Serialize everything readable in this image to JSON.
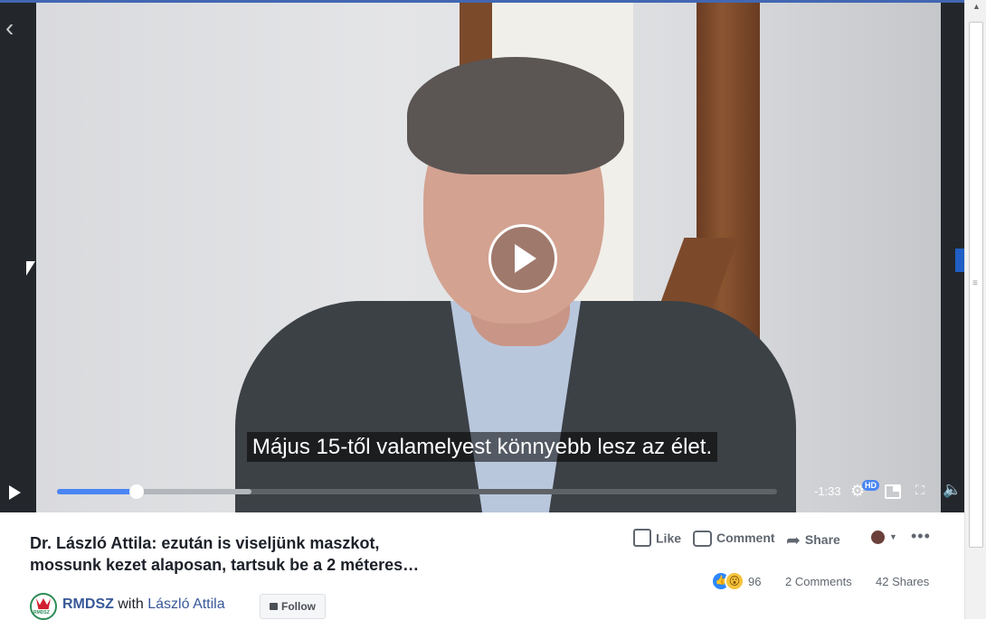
{
  "video": {
    "subtitle": "Május 15-től valamelyest könnyebb lesz az élet.",
    "time_remaining": "-1:33",
    "quality_badge": "HD",
    "progress_fraction": 0.11,
    "buffered_fraction": 0.27
  },
  "post": {
    "title_line1": "Dr. László Attila: ezután is viseljünk maszkot,",
    "title_line2": "mossunk kezet alaposan, tartsuk be a 2 méteres…",
    "page_name": "RMDSZ",
    "with_text": "with",
    "tagged_person": "László Attila",
    "follow_label": "Follow",
    "logo_text": "RMDSZ"
  },
  "actions": {
    "like": "Like",
    "comment": "Comment",
    "share": "Share",
    "more": "•••"
  },
  "stats": {
    "reaction_count": "96",
    "comments": "2 Comments",
    "shares": "42 Shares"
  },
  "icons": [
    "back-arrow-icon",
    "play-icon",
    "settings-icon",
    "picture-in-picture-icon",
    "fullscreen-icon",
    "volume-icon",
    "like-icon",
    "comment-icon",
    "share-icon",
    "more-icon"
  ],
  "colors": {
    "accent": "#4a86f3",
    "link": "#385898",
    "facebook_blue": "#4267b2"
  }
}
